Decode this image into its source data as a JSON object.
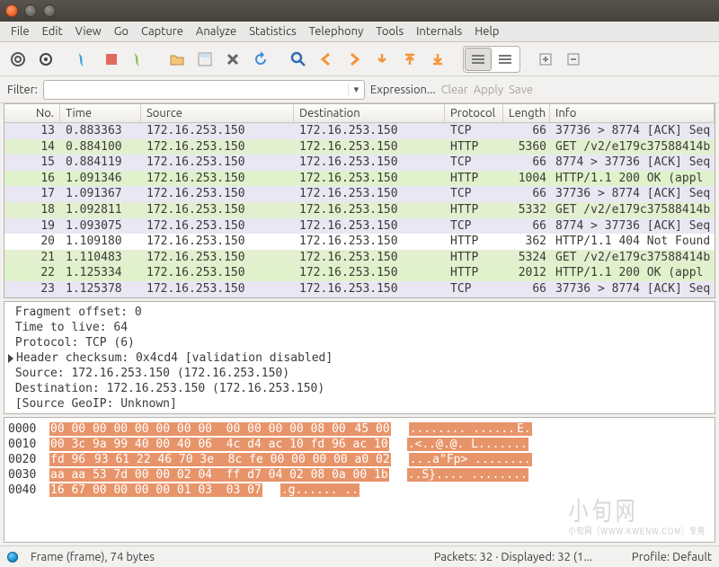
{
  "menu": [
    "File",
    "Edit",
    "View",
    "Go",
    "Capture",
    "Analyze",
    "Statistics",
    "Telephony",
    "Tools",
    "Internals",
    "Help"
  ],
  "filter": {
    "label": "Filter:",
    "value": "",
    "expression": "Expression...",
    "clear": "Clear",
    "apply": "Apply",
    "save": "Save"
  },
  "columns": {
    "no": "No.",
    "time": "Time",
    "src": "Source",
    "dst": "Destination",
    "prot": "Protocol",
    "len": "Length",
    "info": "Info"
  },
  "packets": [
    {
      "no": "13",
      "time": "0.883363",
      "src": "172.16.253.150",
      "dst": "172.16.253.150",
      "prot": "TCP",
      "len": "66",
      "info": "37736 > 8774 [ACK] Seq",
      "bg": "bg-tcp"
    },
    {
      "no": "14",
      "time": "0.884100",
      "src": "172.16.253.150",
      "dst": "172.16.253.150",
      "prot": "HTTP",
      "len": "5360",
      "info": "GET /v2/e179c37588414b",
      "bg": "bg-http1"
    },
    {
      "no": "15",
      "time": "0.884119",
      "src": "172.16.253.150",
      "dst": "172.16.253.150",
      "prot": "TCP",
      "len": "66",
      "info": "8774 > 37736 [ACK] Seq",
      "bg": "bg-tcp"
    },
    {
      "no": "16",
      "time": "1.091346",
      "src": "172.16.253.150",
      "dst": "172.16.253.150",
      "prot": "HTTP",
      "len": "1004",
      "info": "HTTP/1.1 200 OK  (appl",
      "bg": "bg-http2"
    },
    {
      "no": "17",
      "time": "1.091367",
      "src": "172.16.253.150",
      "dst": "172.16.253.150",
      "prot": "TCP",
      "len": "66",
      "info": "37736 > 8774 [ACK] Seq",
      "bg": "bg-tcp"
    },
    {
      "no": "18",
      "time": "1.092811",
      "src": "172.16.253.150",
      "dst": "172.16.253.150",
      "prot": "HTTP",
      "len": "5332",
      "info": "GET /v2/e179c37588414b",
      "bg": "bg-http1"
    },
    {
      "no": "19",
      "time": "1.093075",
      "src": "172.16.253.150",
      "dst": "172.16.253.150",
      "prot": "TCP",
      "len": "66",
      "info": "8774 > 37736 [ACK] Seq",
      "bg": "bg-tcp"
    },
    {
      "no": "20",
      "time": "1.109180",
      "src": "172.16.253.150",
      "dst": "172.16.253.150",
      "prot": "HTTP",
      "len": "362",
      "info": "HTTP/1.1 404 Not Found",
      "bg": "bg-plain"
    },
    {
      "no": "21",
      "time": "1.110483",
      "src": "172.16.253.150",
      "dst": "172.16.253.150",
      "prot": "HTTP",
      "len": "5324",
      "info": "GET /v2/e179c37588414b",
      "bg": "bg-http1"
    },
    {
      "no": "22",
      "time": "1.125334",
      "src": "172.16.253.150",
      "dst": "172.16.253.150",
      "prot": "HTTP",
      "len": "2012",
      "info": "HTTP/1.1 200 OK  (appl",
      "bg": "bg-http2"
    },
    {
      "no": "23",
      "time": "1.125378",
      "src": "172.16.253.150",
      "dst": "172.16.253.150",
      "prot": "TCP",
      "len": "66",
      "info": "37736 > 8774 [ACK] Seq",
      "bg": "bg-tcp"
    }
  ],
  "details": [
    " Fragment offset: 0",
    " Time to live: 64",
    " Protocol: TCP (6)",
    "▸Header checksum: 0x4cd4 [validation disabled]",
    " Source: 172.16.253.150 (172.16.253.150)",
    " Destination: 172.16.253.150 (172.16.253.150)",
    " [Source GeoIP: Unknown]"
  ],
  "hex": [
    {
      "off": "0000",
      "h1": "00 00 00 00 00 00 00 00  00 00 00 00 08 00 ",
      "h2": "45 00",
      "a1": "........ ......",
      "a2": "E.",
      "hl": true
    },
    {
      "off": "0010",
      "h1": "00 3c 9a 99 40 00 40 06  4c d4 ac 10 fd 96 ac 10",
      "h2": "",
      "a1": ".<..@.@. L.......",
      "a2": "",
      "hl": true
    },
    {
      "off": "0020",
      "h1": "fd 96 ",
      "hmid": "93 61 22 46 70 3e  8c fe 00 00 00 00 a0 02",
      "a1": "..",
      "amid": ".a\"Fp> ........",
      "hl": true
    },
    {
      "off": "0030",
      "h1": "aa aa 53 7d 00 00 02 04  ff d7 04 02 08 0a 00 1b",
      "a1": "..S}.... ........",
      "hl": true
    },
    {
      "off": "0040",
      "h1": "16 67 00 00 00 00 01 03  03 07",
      "a1": ".g...... ..",
      "hl": true
    }
  ],
  "status": {
    "frame": "Frame (frame), 74 bytes",
    "packets": "Packets: 32 · Displayed: 32 (1...",
    "profile": "Profile: Default"
  },
  "watermark": {
    "big": "小旬网",
    "small": "小旬网（WWW.KWENW.COM）专用"
  }
}
